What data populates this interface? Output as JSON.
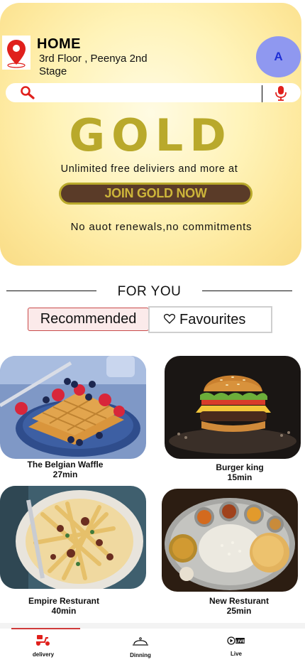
{
  "header": {
    "location_title": "HOME",
    "location_address": "3rd Floor , Peenya 2nd Stage",
    "avatar_initial": "A"
  },
  "search": {
    "placeholder": ""
  },
  "gold": {
    "title": "GOLD",
    "subtitle": "Unlimited free deliviers and more at",
    "cta_label": "JOIN GOLD NOW",
    "footnote": "No auot renewals,no commitments"
  },
  "section": {
    "title": "FOR YOU"
  },
  "tabs": [
    {
      "label": "Recommended",
      "active": true
    },
    {
      "label": "Favourites",
      "active": false
    }
  ],
  "restaurants": [
    {
      "name": "The Belgian Waffle",
      "time": "27min",
      "image": "waffle-photo"
    },
    {
      "name": "Burger king",
      "time": "15min",
      "image": "burger-photo"
    },
    {
      "name": "Empire  Resturant",
      "time": "40min",
      "image": "fries-photo"
    },
    {
      "name": "New Resturant",
      "time": "25min",
      "image": "thali-photo"
    }
  ],
  "bottom_nav": [
    {
      "label": "delivery",
      "icon": "scooter-icon",
      "active": true
    },
    {
      "label": "Dinning",
      "icon": "cloche-icon",
      "active": false
    },
    {
      "label": "Live",
      "icon": "live-icon",
      "active": false
    }
  ],
  "colors": {
    "gold": "#b9a92b",
    "cta_bg": "#5a3b28",
    "accent_red": "#e0201c",
    "avatar_bg": "#8f98f0",
    "avatar_text": "#1f2fd6"
  }
}
